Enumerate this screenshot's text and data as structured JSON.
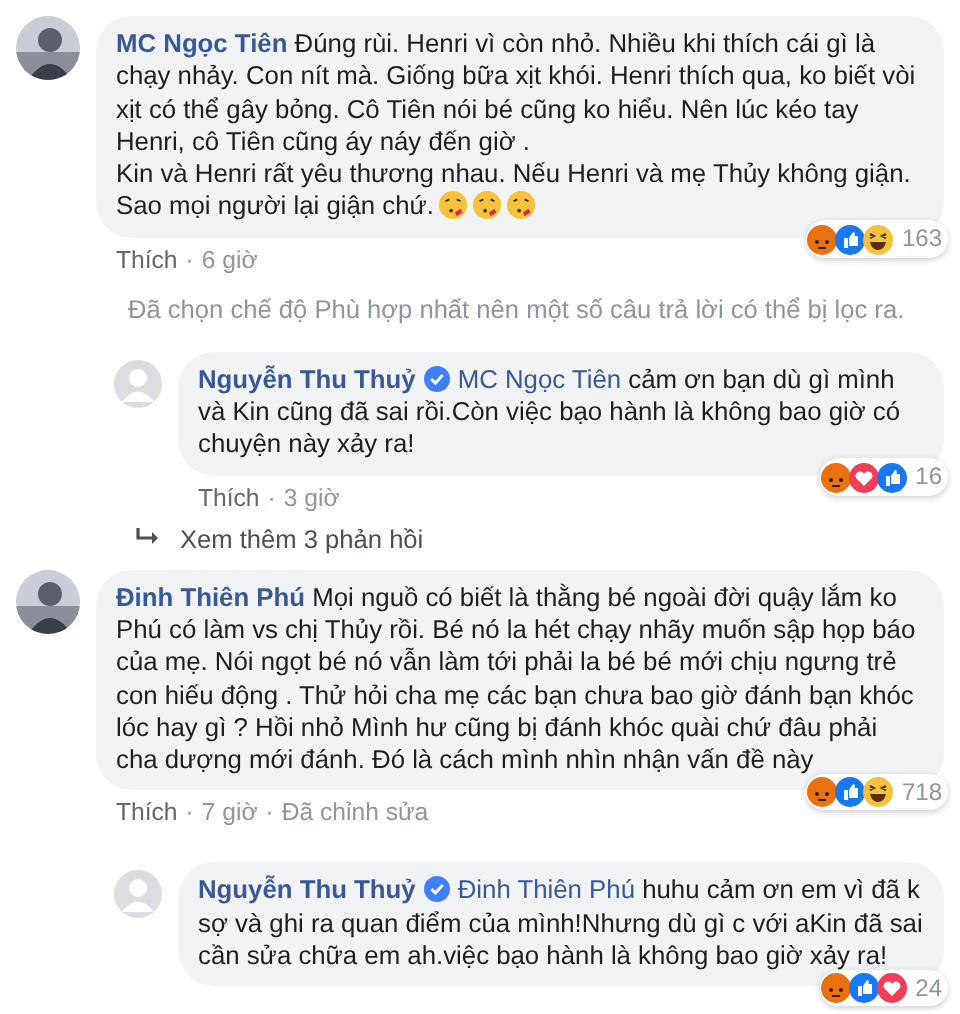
{
  "separator": "·",
  "items": [
    {
      "kind": "comment",
      "reply": false,
      "photo_avatar": true,
      "author": "MC Ngọc Tiên",
      "verified": false,
      "text": "Đúng rùi. Henri vì còn nhỏ. Nhiều khi thích cái gì là chạy nhảy. Con nít mà. Giống bữa xịt khói. Henri thích qua, ko biết vòi xịt có thể gây bỏng. Cô Tiên nói bé cũng ko hiểu. Nên lúc kéo tay Henri, cô Tiên cũng áy náy đến giờ .",
      "text2": "Kin và Henri rất yêu thương nhau. Nếu Henri và mẹ Thủy không giận. Sao mọi người lại giận chứ.",
      "emojis": [
        {
          "kind": "kiss"
        },
        {
          "kind": "kiss"
        },
        {
          "kind": "kiss"
        }
      ],
      "reactions": [
        {
          "kind": "angry"
        },
        {
          "kind": "like"
        },
        {
          "kind": "haha"
        }
      ],
      "count": "163",
      "actions": [
        "Thích",
        "6 giờ"
      ]
    },
    {
      "kind": "notice",
      "text": "Đã chọn chế độ Phù hợp nhất nên một số câu trả lời có thể bị lọc ra."
    },
    {
      "kind": "comment",
      "reply": true,
      "photo_avatar": false,
      "author": "Nguyễn Thu Thuỷ",
      "verified": true,
      "mention": "MC Ngọc Tiên",
      "text": "cảm ơn bạn dù gì mình và Kin cũng đã sai rồi.Còn việc bạo hành là không bao giờ có chuyện này xảy ra!",
      "reactions": [
        {
          "kind": "angry"
        },
        {
          "kind": "love"
        },
        {
          "kind": "like"
        }
      ],
      "count": "16",
      "actions": [
        "Thích",
        "3 giờ"
      ]
    },
    {
      "kind": "more",
      "text": "Xem thêm 3 phản hồi"
    },
    {
      "kind": "comment",
      "reply": false,
      "photo_avatar": true,
      "author": "Đinh Thiên Phú",
      "verified": false,
      "text": "Mọi nguồ có biết là thằng bé ngoài đời quậy lắm ko Phú có làm vs chị Thủy rồi. Bé nó la hét chạy nhãy muốn sập họp báo của mẹ. Nói ngọt bé nó vẫn làm tới phải la bé bé mới chịu ngưng trẻ con hiếu động . Thử hỏi cha mẹ các bạn chưa bao giờ đánh bạn khóc lóc hay gì ? Hồi nhỏ Mình hư cũng bị đánh khóc quài chứ đâu phải cha dượng mới đánh. Đó là cách mình nhìn nhận vấn đề này",
      "reactions": [
        {
          "kind": "angry"
        },
        {
          "kind": "like"
        },
        {
          "kind": "haha"
        }
      ],
      "count": "718",
      "actions": [
        "Thích",
        "7 giờ",
        "Đã chỉnh sửa"
      ]
    },
    {
      "kind": "comment",
      "reply": true,
      "photo_avatar": false,
      "author": "Nguyễn Thu Thuỷ",
      "verified": true,
      "mention": "Đinh Thiên Phú",
      "text": "huhu cảm ơn em vì đã k sợ và ghi ra quan điểm của mình!Nhưng dù gì c với aKin đã sai cần sửa chữa em ah.việc bạo hành là không bao giờ xảy ra!",
      "reactions": [
        {
          "kind": "angry"
        },
        {
          "kind": "like"
        },
        {
          "kind": "love"
        }
      ],
      "count": "24"
    }
  ]
}
